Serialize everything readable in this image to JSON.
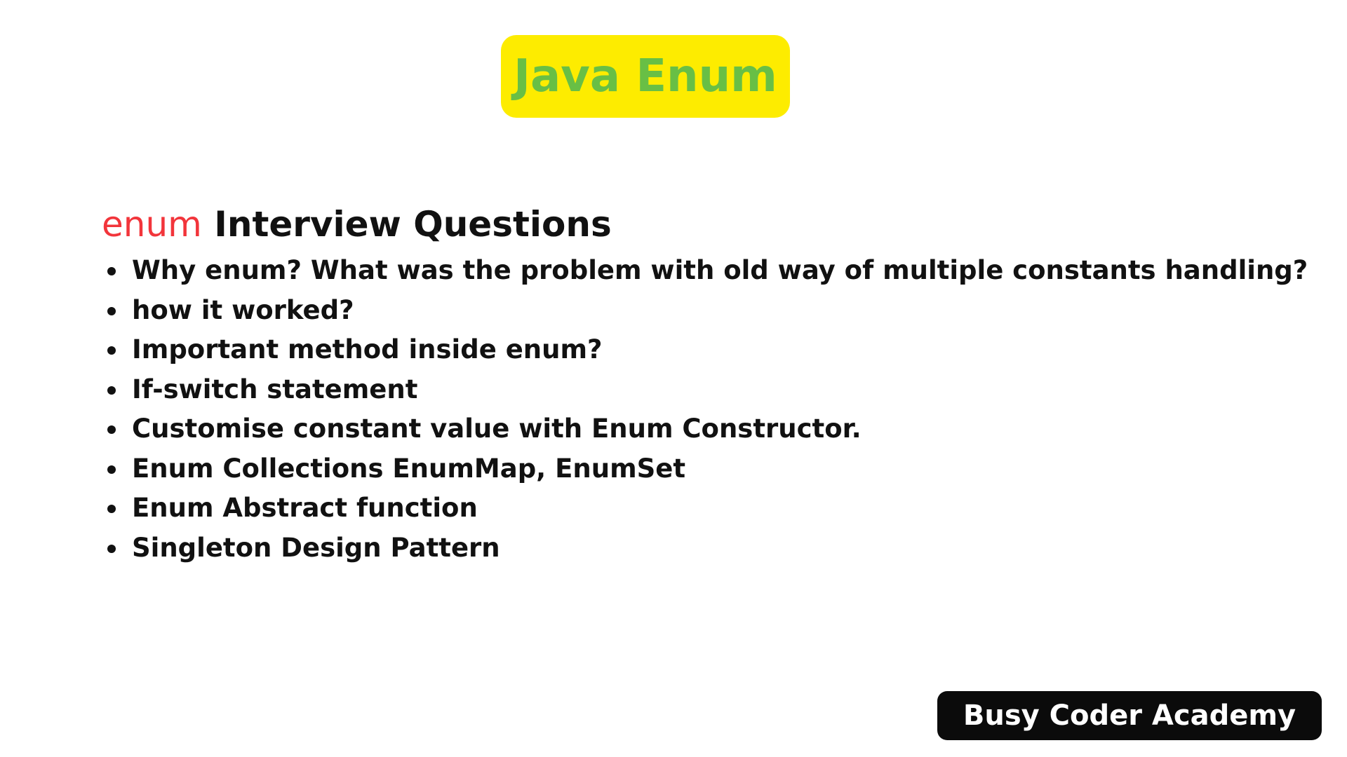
{
  "title": "Java Enum",
  "heading": {
    "accent": "enum",
    "rest": "Interview Questions"
  },
  "questions": [
    "Why enum? What was the problem with old way of multiple constants handling?",
    "how it worked?",
    "Important method inside enum?",
    "If-switch statement",
    "Customise constant value with Enum Constructor.",
    "Enum Collections EnumMap, EnumSet",
    "Enum Abstract function",
    "Singleton Design Pattern"
  ],
  "brand": "Busy Coder Academy",
  "colors": {
    "title_badge_bg": "#fdec00",
    "title_text": "#68bf45",
    "accent": "#f2353b",
    "brand_badge_bg": "#0b0b0b",
    "brand_text": "#ffffff"
  }
}
